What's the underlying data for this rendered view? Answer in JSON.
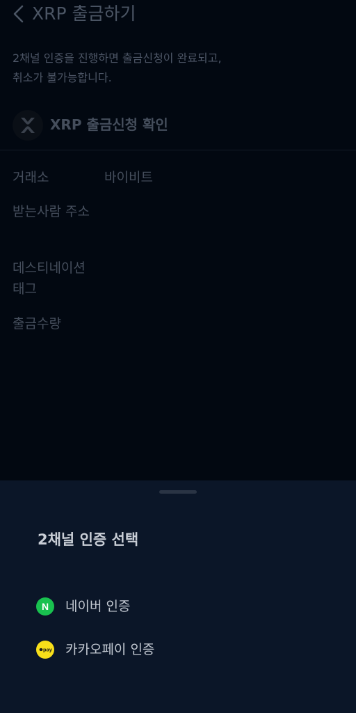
{
  "header": {
    "title": "XRP 출금하기",
    "back_icon": "chevron-left-icon"
  },
  "notice": {
    "line1": "2채널 인증을 진행하면 출금신청이 완료되고,",
    "line2": "취소가 불가능합니다."
  },
  "confirm": {
    "coin_icon": "xrp-logo-icon",
    "title": "XRP 출금신청 확인"
  },
  "details": {
    "exchange_label": "거래소",
    "exchange_value": "바이비트",
    "address_label": "받는사람 주소",
    "tag_label_line1": "데스티네이션",
    "tag_label_line2": "태그",
    "amount_label": "출금수량"
  },
  "sheet": {
    "title": "2채널 인증 선택",
    "options": [
      {
        "icon": "naver-icon",
        "icon_text": "N",
        "label": "네이버 인증"
      },
      {
        "icon": "kakaopay-icon",
        "icon_text": "pay",
        "label": "카카오페이 인증"
      }
    ]
  },
  "colors": {
    "naver_green": "#19c14f",
    "kakao_yellow": "#f8df1a",
    "sheet_bg": "#0b1628",
    "page_bg": "#020811"
  }
}
